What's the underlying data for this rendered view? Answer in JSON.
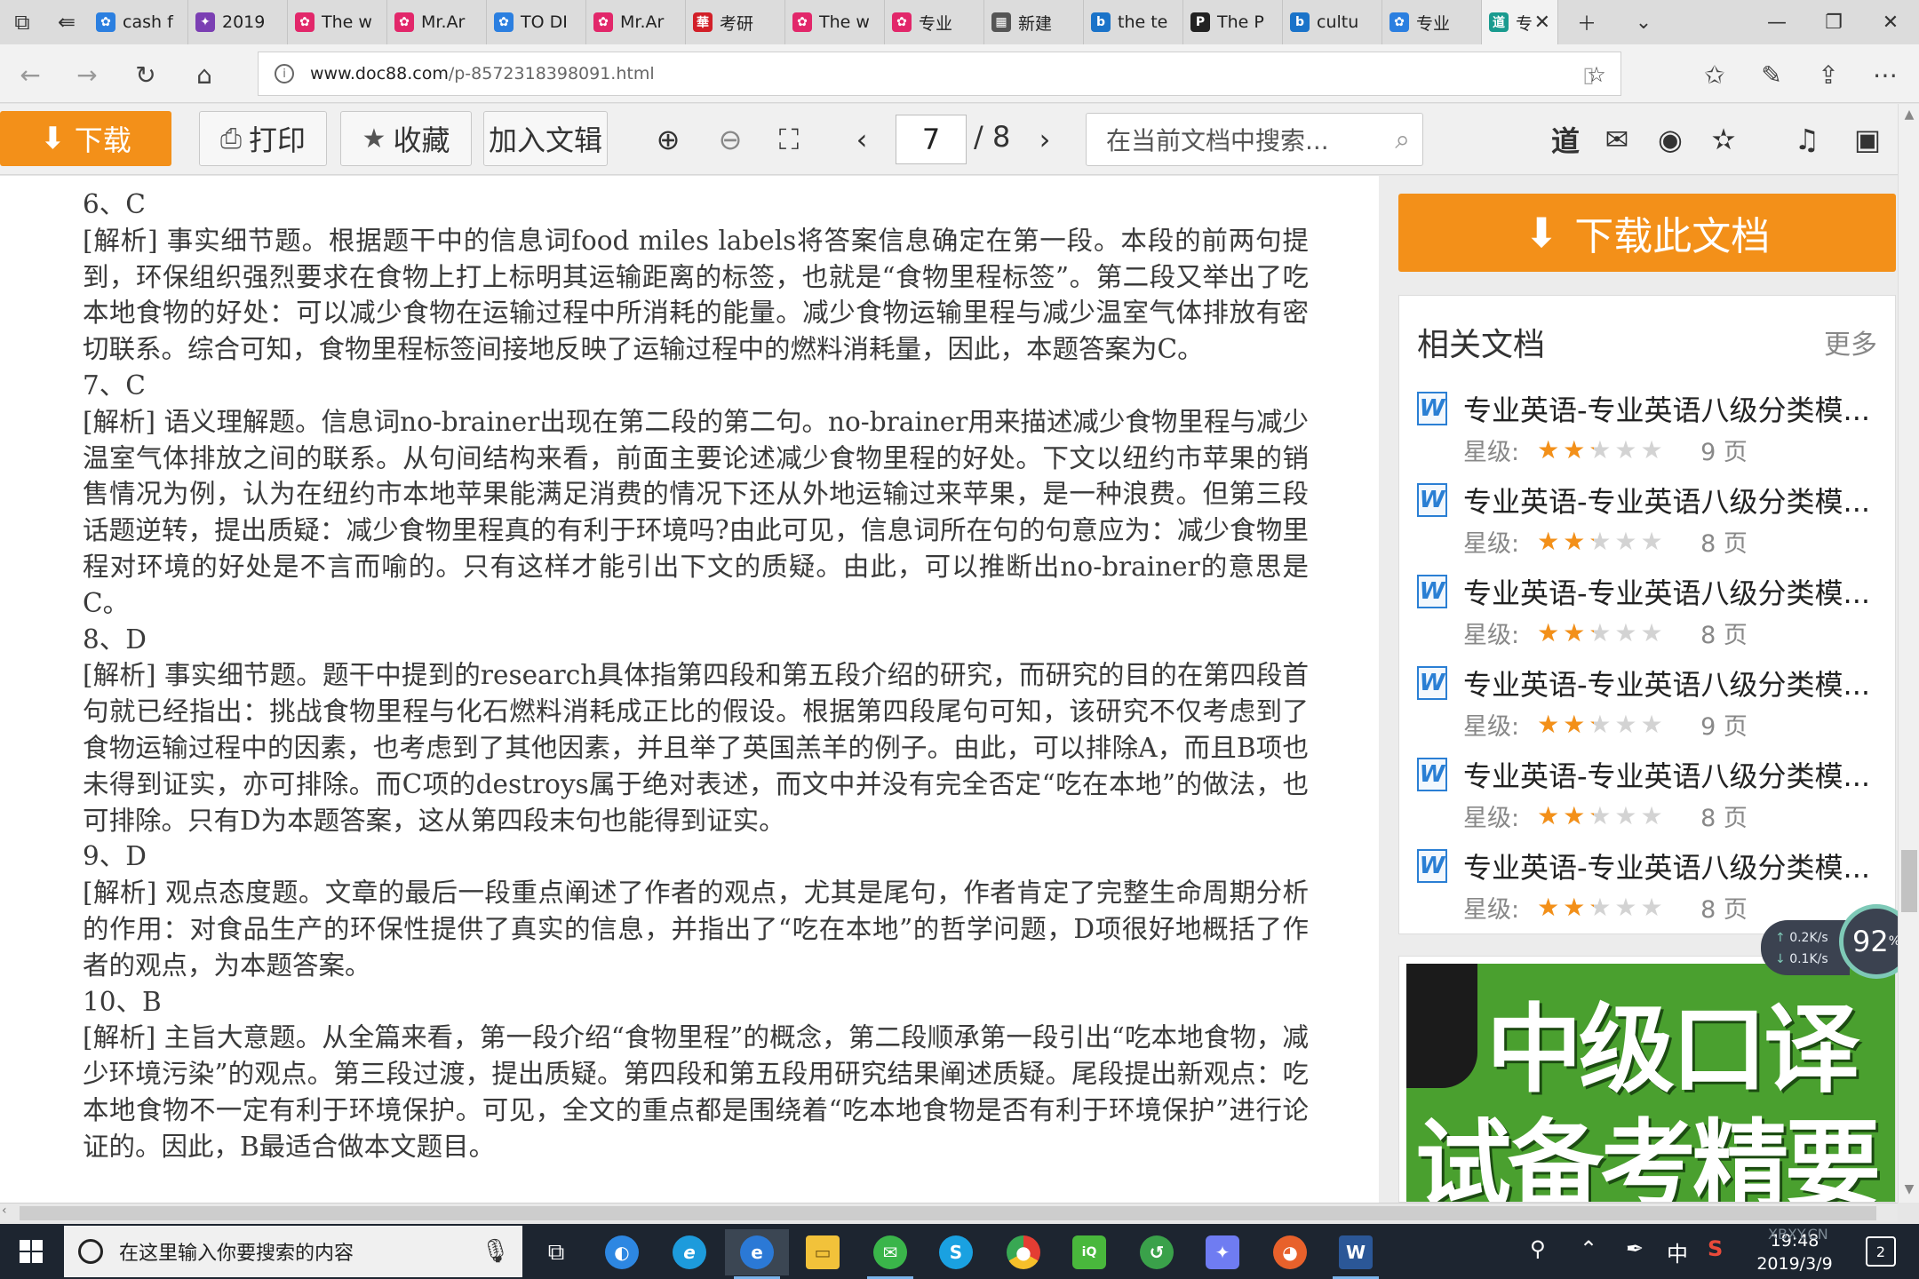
{
  "browser": {
    "tabs": [
      {
        "label": "cash f",
        "color": "#2b7fe0",
        "glyph": "✿"
      },
      {
        "label": "2019",
        "color": "#7b3fb3",
        "glyph": "✦"
      },
      {
        "label": "The w",
        "color": "#e2276a",
        "glyph": "✿"
      },
      {
        "label": "Mr.Ar",
        "color": "#e2276a",
        "glyph": "✿"
      },
      {
        "label": "TO DI",
        "color": "#2b7fe0",
        "glyph": "✿"
      },
      {
        "label": "Mr.Ar",
        "color": "#e2276a",
        "glyph": "✿"
      },
      {
        "label": "考研",
        "color": "#d21f28",
        "glyph": "華"
      },
      {
        "label": "The w",
        "color": "#e2276a",
        "glyph": "✿"
      },
      {
        "label": "专业",
        "color": "#e2276a",
        "glyph": "✿"
      },
      {
        "label": "新建",
        "color": "#555555",
        "glyph": "▦"
      },
      {
        "label": "the te",
        "color": "#1a73c9",
        "glyph": "b"
      },
      {
        "label": "The P",
        "color": "#222222",
        "glyph": "P"
      },
      {
        "label": "cultu",
        "color": "#1a73c9",
        "glyph": "b"
      },
      {
        "label": "专业",
        "color": "#2b7fe0",
        "glyph": "✿"
      },
      {
        "label": "专",
        "color": "#1a9b8f",
        "glyph": "道",
        "active": true
      }
    ],
    "url": "www.doc88.com",
    "url_path": "/p-8572318398091.html"
  },
  "toolbar": {
    "download": "下载",
    "print": "打印",
    "favorite": "收藏",
    "add_to_album": "加入文辑",
    "current_page": "7",
    "total_pages": "/ 8",
    "search_placeholder": "在当前文档中搜索..."
  },
  "document": {
    "paragraphs": [
      "6、C",
      "[解析] 事实细节题。根据题干中的信息词food miles labels将答案信息确定在第一段。本段的前两句提到，环保组织强烈要求在食物上打上标明其运输距离的标签，也就是“食物里程标签”。第二段又举出了吃本地食物的好处：可以减少食物在运输过程中所消耗的能量。减少食物运输里程与减少温室气体排放有密切联系。综合可知，食物里程标签间接地反映了运输过程中的燃料消耗量，因此，本题答案为C。",
      "7、C",
      "[解析] 语义理解题。信息词no-brainer出现在第二段的第二句。no-brainer用来描述减少食物里程与减少温室气体排放之间的联系。从句间结构来看，前面主要论述减少食物里程的好处。下文以纽约市苹果的销售情况为例，认为在纽约市本地苹果能满足消费的情况下还从外地运输过来苹果，是一种浪费。但第三段话题逆转，提出质疑：减少食物里程真的有利于环境吗?由此可见，信息词所在句的句意应为：减少食物里程对环境的好处是不言而喻的。只有这样才能引出下文的质疑。由此，可以推断出no-brainer的意思是C。",
      "8、D",
      "[解析] 事实细节题。题干中提到的research具体指第四段和第五段介绍的研究，而研究的目的在第四段首句就已经指出：挑战食物里程与化石燃料消耗成正比的假设。根据第四段尾句可知，该研究不仅考虑到了食物运输过程中的因素，也考虑到了其他因素，并且举了英国羔羊的例子。由此，可以排除A，而且B项也未得到证实，亦可排除。而C项的destroys属于绝对表述，而文中并没有完全否定“吃在本地”的做法，也可排除。只有D为本题答案，这从第四段末句也能得到证实。",
      "9、D",
      "[解析] 观点态度题。文章的最后一段重点阐述了作者的观点，尤其是尾句，作者肯定了完整生命周期分析的作用：对食品生产的环保性提供了真实的信息，并指出了“吃在本地”的哲学问题，D项很好地概括了作者的观点，为本题答案。",
      "10、B",
      "[解析] 主旨大意题。从全篇来看，第一段介绍“食物里程”的概念，第二段顺承第一段引出“吃本地食物，减少环境污染”的观点。第三段过渡，提出质疑。第四段和第五段用研究结果阐述质疑。尾段提出新观点：吃本地食物不一定有利于环境保护。可见，全文的重点都是围绕着“吃本地食物是否有利于环境保护”进行论证的。因此，B最适合做本文题目。"
    ]
  },
  "sidebar": {
    "download_doc": "下载此文档",
    "related_title": "相关文档",
    "more": "更多",
    "rating_label": "星级:",
    "related": [
      {
        "title": "专业英语-专业英语八级分类模...",
        "stars": 2,
        "max_stars": 5,
        "pages": "9 页"
      },
      {
        "title": "专业英语-专业英语八级分类模...",
        "stars": 2,
        "max_stars": 5,
        "pages": "8 页"
      },
      {
        "title": "专业英语-专业英语八级分类模...",
        "stars": 2,
        "max_stars": 5,
        "pages": "8 页"
      },
      {
        "title": "专业英语-专业英语八级分类模...",
        "stars": 2,
        "max_stars": 5,
        "pages": "9 页"
      },
      {
        "title": "专业英语-专业英语八级分类模...",
        "stars": 2,
        "max_stars": 5,
        "pages": "8 页"
      },
      {
        "title": "专业英语-专业英语八级分类模...",
        "stars": 2,
        "max_stars": 5,
        "pages": "8 页"
      }
    ],
    "ad_line1": "中级口译",
    "ad_line2": "试备考精要",
    "net": {
      "up": "0.2K/s",
      "down": "0.1K/s",
      "percent": "92",
      "unit": "%"
    }
  },
  "taskbar": {
    "search_placeholder": "在这里输入你要搜索的内容",
    "ime": "中",
    "time": "19:48",
    "date": "2019/3/9",
    "notifications": "2"
  },
  "watermark": "XBXY.CN"
}
